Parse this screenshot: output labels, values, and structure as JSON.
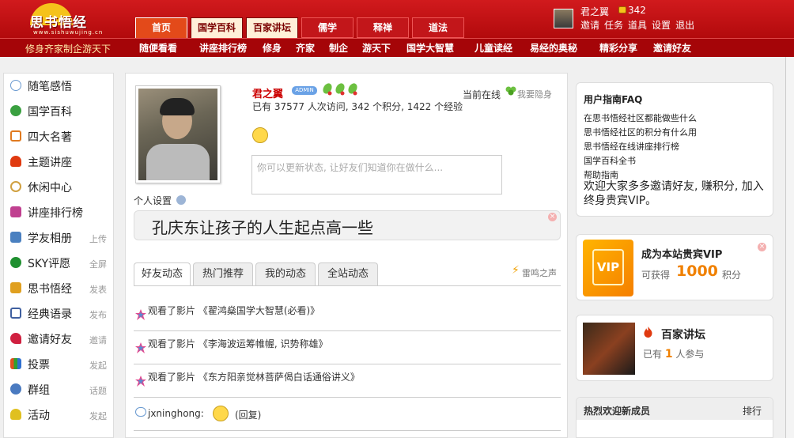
{
  "header": {
    "logo_text": "思书悟经",
    "logo_sub": "www.sishuwujing.cn",
    "slogan": "修身齐家制企游天下",
    "main_tabs": [
      "首页",
      "国学百科",
      "百家讲坛",
      "儒学",
      "释禅",
      "道法"
    ],
    "sub_nav": [
      "随便看看",
      "讲座排行榜",
      "修身",
      "齐家",
      "制企",
      "游天下",
      "国学大智慧",
      "儿童读经",
      "易经的奥秘",
      "精彩分享",
      "邀请好友"
    ],
    "user": {
      "name": "君之翼",
      "coins": "342",
      "links": [
        "邀请",
        "任务",
        "道具",
        "设置",
        "退出"
      ]
    }
  },
  "sidebar": {
    "items": [
      {
        "label": "随笔感悟",
        "action": "",
        "icon": "chat-bubble-icon",
        "color": "#6a9ad0"
      },
      {
        "label": "国学百科",
        "action": "",
        "icon": "flower-icon",
        "color": "#3aa040"
      },
      {
        "label": "四大名著",
        "action": "",
        "icon": "bag-icon",
        "color": "#e07a20"
      },
      {
        "label": "主题讲座",
        "action": "",
        "icon": "fire-icon",
        "color": "#e03a10"
      },
      {
        "label": "休闲中心",
        "action": "",
        "icon": "clock-icon",
        "color": "#d0a040"
      },
      {
        "label": "讲座排行榜",
        "action": "",
        "icon": "star-icon",
        "color": "#c04090"
      },
      {
        "label": "学友相册",
        "action": "上传",
        "icon": "photo-icon",
        "color": "#4a80c0"
      },
      {
        "label": "SKY评愿",
        "action": "全屏",
        "icon": "star-circle-icon",
        "color": "#209030"
      },
      {
        "label": "思书悟经",
        "action": "发表",
        "icon": "book-icon",
        "color": "#e0a020"
      },
      {
        "label": "经典语录",
        "action": "发布",
        "icon": "grid-icon",
        "color": "#4060a0"
      },
      {
        "label": "邀请好友",
        "action": "邀请",
        "icon": "heart-icon",
        "color": "#d02040"
      },
      {
        "label": "投票",
        "action": "发起",
        "icon": "bar-chart-icon",
        "color": "#e05020"
      },
      {
        "label": "群组",
        "action": "话题",
        "icon": "group-icon",
        "color": "#4a7ac0"
      },
      {
        "label": "活动",
        "action": "发起",
        "icon": "bulb-icon",
        "color": "#e0c020"
      }
    ]
  },
  "profile": {
    "name": "君之翼",
    "badge": "ADMIN",
    "stats": "已有 37577 人次访问, 342 个积分, 1422 个经验",
    "online": "当前在线",
    "hide": "我要隐身",
    "status_placeholder": "你可以更新状态, 让好友们知道你在做什么...",
    "settings": "个人设置",
    "motto": "孔庆东让孩子的人生起点高一些"
  },
  "feed": {
    "tabs": [
      "好友动态",
      "热门推荐",
      "我的动态",
      "全站动态"
    ],
    "thunder": "雷鸣之声",
    "items": [
      {
        "text": "观看了影片 《翟鸿燊国学大智慧(必看)》",
        "type": "movie"
      },
      {
        "text": "观看了影片 《李海波运筹帷幄, 识势称雄》",
        "type": "movie"
      },
      {
        "text": "观看了影片 《东方阳亲觉林菩萨偈白话通俗讲义》",
        "type": "movie"
      },
      {
        "text": "jxninghong:",
        "suffix": "(回复)",
        "type": "chat"
      }
    ]
  },
  "right": {
    "faq": {
      "title": "用户指南FAQ",
      "items": [
        "在思书悟经社区都能做些什么",
        "思书悟经社区的积分有什么用",
        "思书悟经在线讲座排行榜",
        "国学百科全书",
        "帮助指南"
      ],
      "invite": "欢迎大家多多邀请好友, 赚积分, 加入终身贵宾VIP。"
    },
    "vip": {
      "img_text": "VIP",
      "title": "成为本站贵宾VIP",
      "gain": "可获得",
      "points": "1000",
      "unit": "积分"
    },
    "lecture": {
      "title": "百家讲坛",
      "prefix": "已有",
      "count": "1",
      "suffix": "人参与"
    },
    "new_members": {
      "title": "热烈欢迎新成员",
      "rank": "排行"
    }
  }
}
